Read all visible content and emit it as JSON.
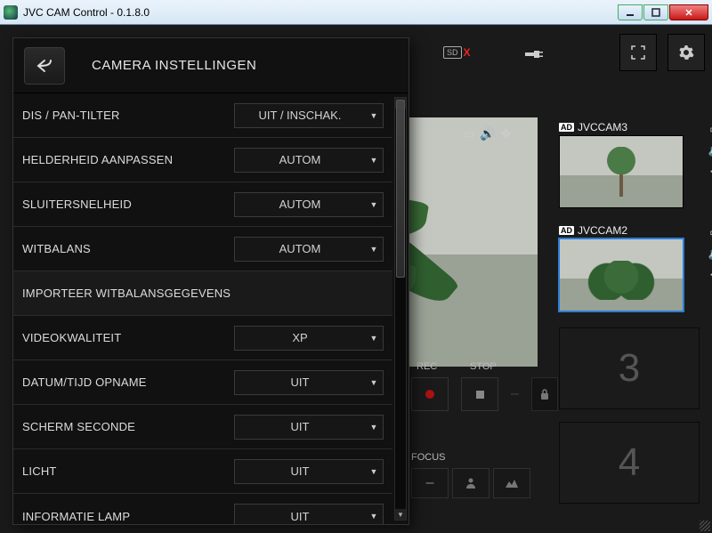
{
  "window": {
    "title": "JVC CAM Control - 0.1.8.0"
  },
  "panel": {
    "title": "CAMERA INSTELLINGEN",
    "rows": [
      {
        "label": "DIS / PAN-TILTER",
        "value": "UIT / INSCHAK."
      },
      {
        "label": "HELDERHEID AANPASSEN",
        "value": "AUTOM"
      },
      {
        "label": "SLUITERSNELHEID",
        "value": "AUTOM"
      },
      {
        "label": "WITBALANS",
        "value": "AUTOM"
      },
      {
        "label": "IMPORTEER WITBALANSGEGEVENS",
        "simple": true
      },
      {
        "label": "VIDEOKWALITEIT",
        "value": "XP"
      },
      {
        "label": "DATUM/TIJD OPNAME",
        "value": "UIT"
      },
      {
        "label": "SCHERM SECONDE",
        "value": "UIT"
      },
      {
        "label": "LICHT",
        "value": "UIT"
      },
      {
        "label": "INFORMATIE LAMP",
        "value": "UIT"
      }
    ]
  },
  "controls": {
    "rec": "REC",
    "stop": "STOP",
    "focus": "FOCUS"
  },
  "cams": {
    "list": [
      {
        "badge": "AD",
        "name": "JVCCAM3",
        "selected": false,
        "kind": "tree"
      },
      {
        "badge": "AD",
        "name": "JVCCAM2",
        "selected": true,
        "kind": "plant"
      }
    ],
    "slots": [
      "3",
      "4"
    ]
  },
  "sd": {
    "label": "SD",
    "x": "X"
  }
}
